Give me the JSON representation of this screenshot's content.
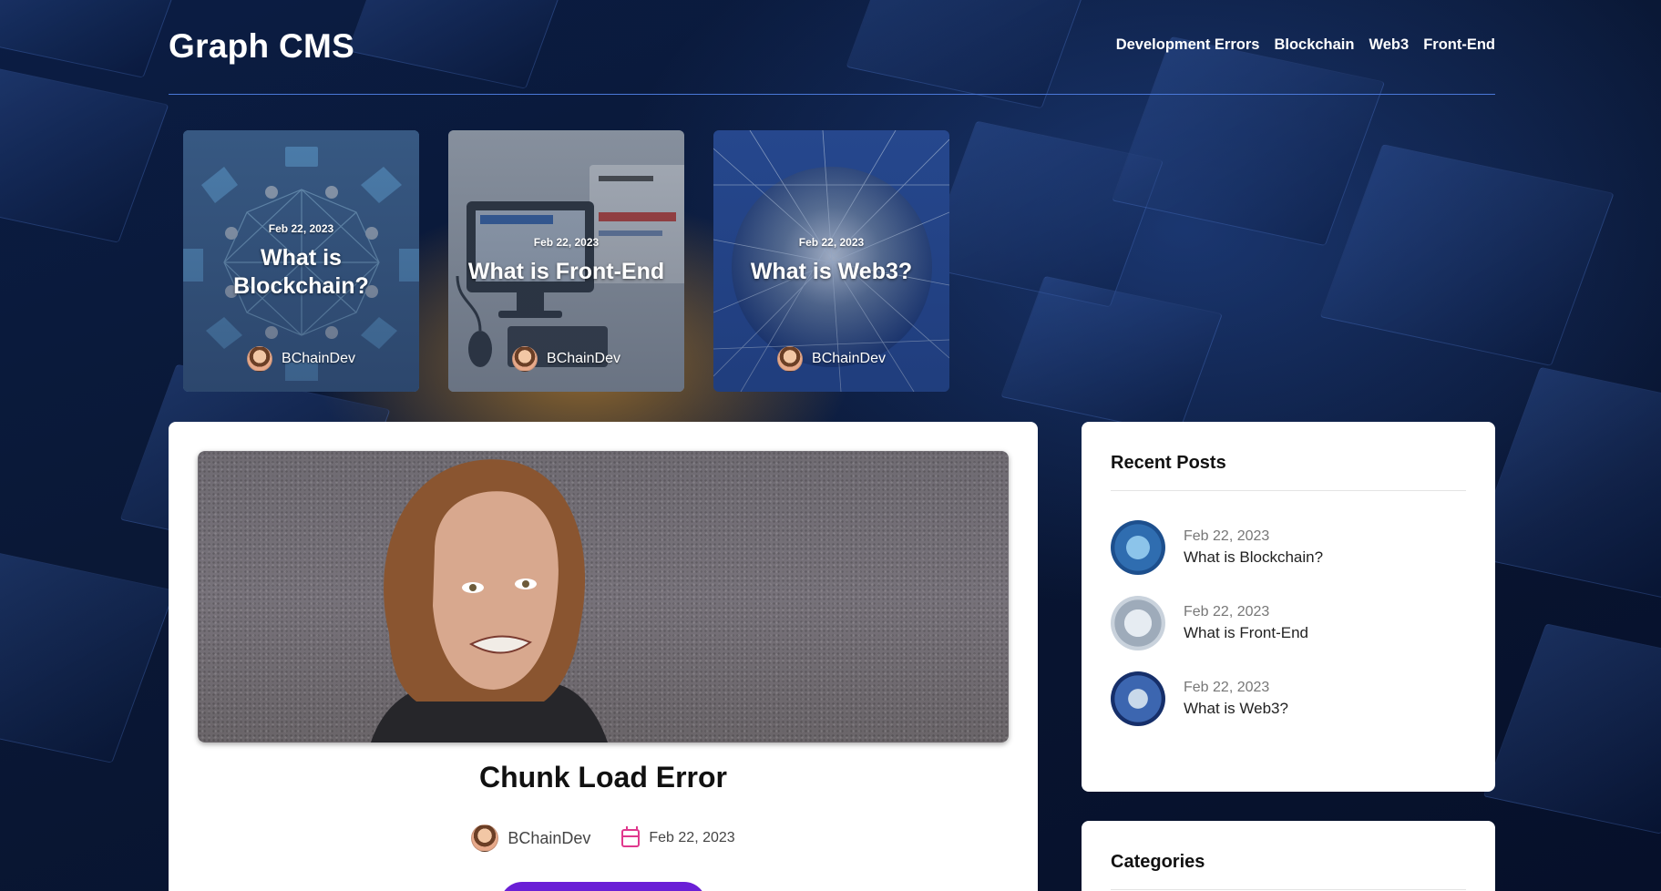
{
  "header": {
    "brand": "Graph CMS",
    "nav": [
      "Development Errors",
      "Blockchain",
      "Web3",
      "Front-End"
    ]
  },
  "featured": [
    {
      "date": "Feb 22, 2023",
      "title": "What is Blockchain?",
      "author": "BChainDev"
    },
    {
      "date": "Feb 22, 2023",
      "title": "What is Front-End",
      "author": "BChainDev"
    },
    {
      "date": "Feb 22, 2023",
      "title": "What is Web3?",
      "author": "BChainDev"
    }
  ],
  "post": {
    "title": "Chunk Load Error",
    "author": "BChainDev",
    "date": "Feb 22, 2023"
  },
  "recent": {
    "heading": "Recent Posts",
    "items": [
      {
        "date": "Feb 22, 2023",
        "title": "What is Blockchain?"
      },
      {
        "date": "Feb 22, 2023",
        "title": "What is Front-End"
      },
      {
        "date": "Feb 22, 2023",
        "title": "What is Web3?"
      }
    ]
  },
  "categories": {
    "heading": "Categories"
  },
  "colors": {
    "accent": "#6a1fd6",
    "calendar": "#e0388d",
    "header_rule": "#4a78d8"
  }
}
